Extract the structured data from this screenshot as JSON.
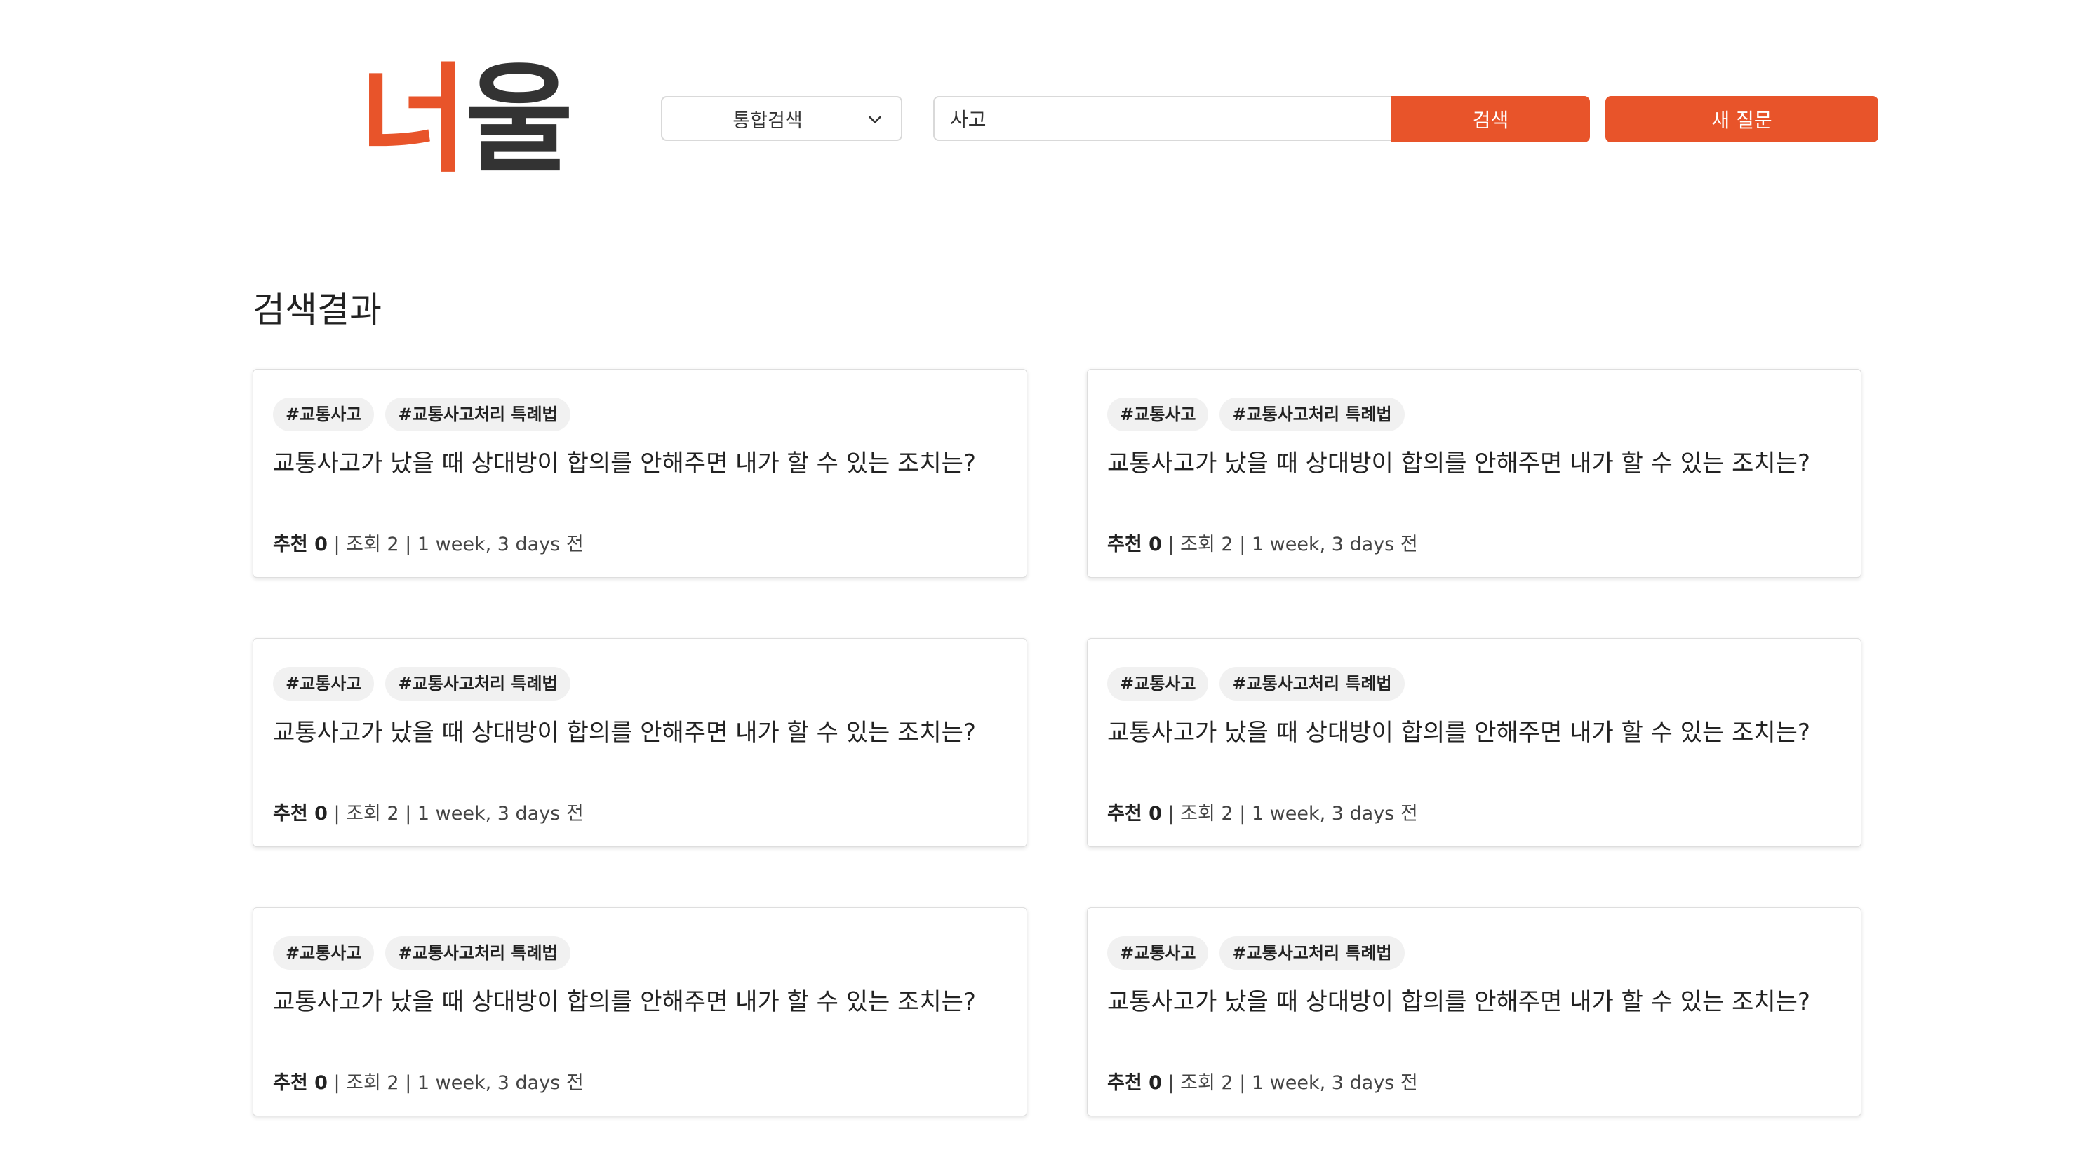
{
  "logo": {
    "part1": "너",
    "part2": "울"
  },
  "search": {
    "scope_selected": "통합검색",
    "query_value": "사고",
    "search_button_label": "검색",
    "new_question_label": "새 질문"
  },
  "section": {
    "title": "검색결과"
  },
  "colors": {
    "accent": "#e8542a",
    "logo_dark": "#333333"
  },
  "results": [
    {
      "tags": [
        "#교통사고",
        "#교통사고처리 특례법"
      ],
      "title": "교통사고가 났을 때 상대방이 합의를 안해주면 내가 할 수 있는 조치는?",
      "recommend_label": "추천 0",
      "views_label": "조회 2",
      "time_label": "1 week, 3 days 전"
    },
    {
      "tags": [
        "#교통사고",
        "#교통사고처리 특례법"
      ],
      "title": "교통사고가 났을 때 상대방이 합의를 안해주면 내가 할 수 있는 조치는?",
      "recommend_label": "추천 0",
      "views_label": "조회 2",
      "time_label": "1 week, 3 days 전"
    },
    {
      "tags": [
        "#교통사고",
        "#교통사고처리 특례법"
      ],
      "title": "교통사고가 났을 때 상대방이 합의를 안해주면 내가 할 수 있는 조치는?",
      "recommend_label": "추천 0",
      "views_label": "조회 2",
      "time_label": "1 week, 3 days 전"
    },
    {
      "tags": [
        "#교통사고",
        "#교통사고처리 특례법"
      ],
      "title": "교통사고가 났을 때 상대방이 합의를 안해주면 내가 할 수 있는 조치는?",
      "recommend_label": "추천 0",
      "views_label": "조회 2",
      "time_label": "1 week, 3 days 전"
    },
    {
      "tags": [
        "#교통사고",
        "#교통사고처리 특례법"
      ],
      "title": "교통사고가 났을 때 상대방이 합의를 안해주면 내가 할 수 있는 조치는?",
      "recommend_label": "추천 0",
      "views_label": "조회 2",
      "time_label": "1 week, 3 days 전"
    },
    {
      "tags": [
        "#교통사고",
        "#교통사고처리 특례법"
      ],
      "title": "교통사고가 났을 때 상대방이 합의를 안해주면 내가 할 수 있는 조치는?",
      "recommend_label": "추천 0",
      "views_label": "조회 2",
      "time_label": "1 week, 3 days 전"
    }
  ]
}
